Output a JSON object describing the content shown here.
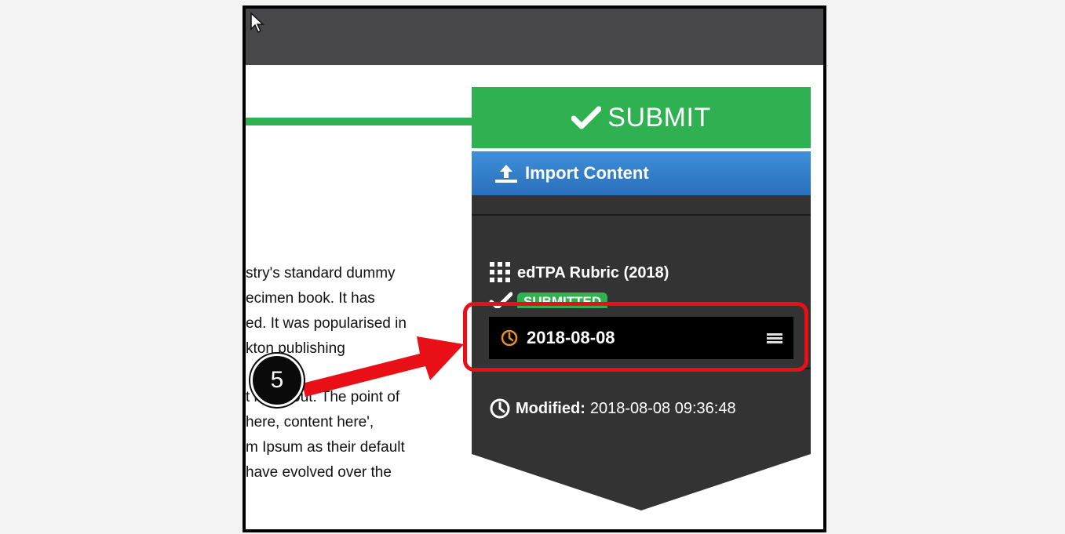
{
  "body_text": {
    "lines_a": [
      "stry's standard dummy",
      "ecimen book. It has",
      "ed. It was popularised in",
      "kton publishing"
    ],
    "lines_b": [
      "t its layout. The point of",
      "here, content here',",
      "m Ipsum as their default",
      "have evolved over the"
    ]
  },
  "panel": {
    "submit_label": "SUBMIT",
    "import_label": "Import Content",
    "rubric_title": "edTPA Rubric (2018)",
    "status_badge": "SUBMITTED",
    "date_value": "2018-08-08",
    "modified_label": "Modified:",
    "modified_value": "2018-08-08 09:36:48"
  },
  "annotation": {
    "step_number": "5"
  },
  "icons": {
    "submit": "checkmark-icon",
    "import": "upload-icon",
    "rubric": "grid-icon",
    "status": "checkmark-icon",
    "date": "clock-icon",
    "menu": "hamburger-icon",
    "modified": "clock-icon",
    "cursor": "mouse-pointer-icon"
  },
  "colors": {
    "accent_green": "#2fb152",
    "import_blue": "#2f7fce",
    "panel_dark": "#333333",
    "highlight_red": "#e81016",
    "clock_orange": "#e8902a"
  }
}
